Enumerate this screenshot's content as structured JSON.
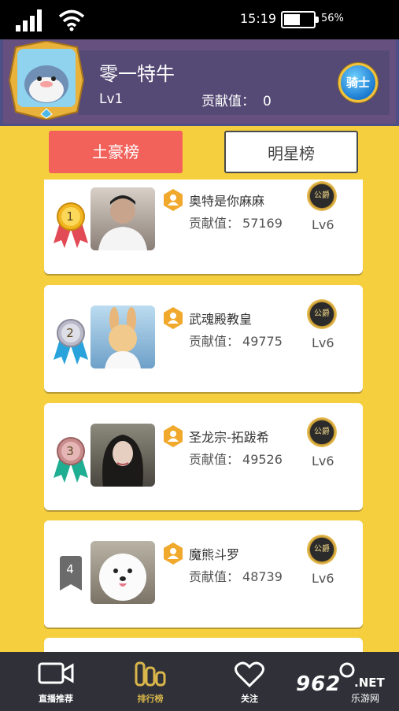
{
  "status_bar": {
    "time": "15:19",
    "battery_percent": "56%",
    "battery_level": 0.56
  },
  "profile": {
    "username": "零一特牛",
    "level": "Lv1",
    "contribution_label": "贡献值：",
    "contribution_value": "0",
    "badge": "骑士"
  },
  "tabs": {
    "rich_list": "土豪榜",
    "star_list": "明星榜"
  },
  "ranking": [
    {
      "rank": "1",
      "name": "奥特是你麻麻",
      "score_label": "贡献值：",
      "score": "57169",
      "title_badge": "公爵",
      "level": "Lv6",
      "medal": "gold"
    },
    {
      "rank": "2",
      "name": "武魂殿教皇",
      "score_label": "贡献值：",
      "score": "49775",
      "title_badge": "公爵",
      "level": "Lv6",
      "medal": "silver"
    },
    {
      "rank": "3",
      "name": "圣龙宗-拓跋希",
      "score_label": "贡献值：",
      "score": "49526",
      "title_badge": "公爵",
      "level": "Lv6",
      "medal": "bronze"
    },
    {
      "rank": "4",
      "name": "魔熊斗罗",
      "score_label": "贡献值：",
      "score": "48739",
      "title_badge": "公爵",
      "level": "Lv6",
      "medal": "plain"
    }
  ],
  "nav": {
    "live": "直播推荐",
    "rank": "排行榜",
    "follow": "关注"
  },
  "watermark": {
    "num": "962",
    "net": ".NET",
    "cn": "乐游网"
  }
}
